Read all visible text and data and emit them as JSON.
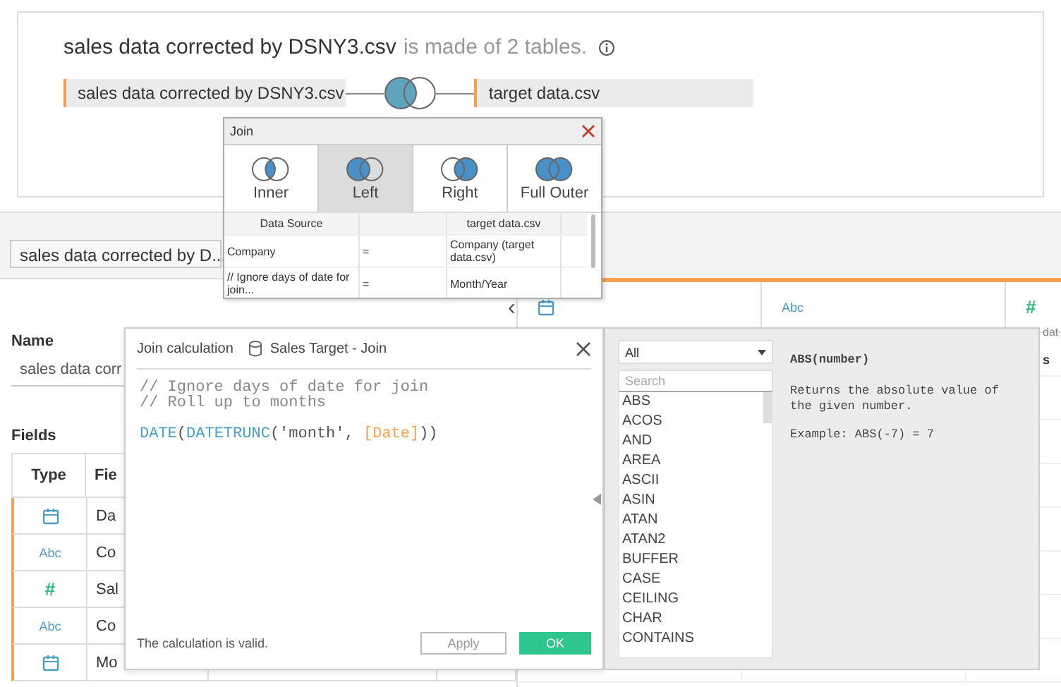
{
  "header": {
    "title": "sales data corrected by DSNY3.csv",
    "subtitle": "is made of 2 tables."
  },
  "join_diagram": {
    "left_table": "sales data corrected by DSNY3.csv",
    "right_table": "target data.csv",
    "left_shaded": true,
    "right_shaded": false
  },
  "source_selector": {
    "value": "sales data corrected by D..."
  },
  "details": {
    "name_label": "Name",
    "name_value": "sales data corr",
    "fields_label": "Fields",
    "collapse_glyph": "‹",
    "columns": [
      "Type",
      "Fie"
    ],
    "rows": [
      {
        "kind": "date",
        "field": "Da"
      },
      {
        "kind": "string",
        "glyph": "Abc",
        "field": "Co"
      },
      {
        "kind": "number",
        "glyph": "#",
        "field": "Sal"
      },
      {
        "kind": "string",
        "glyph": "Abc",
        "field": "Co"
      },
      {
        "kind": "date",
        "field": "Mo"
      }
    ]
  },
  "grid_header": {
    "columns": [
      {
        "kind": "date"
      },
      {
        "kind": "string",
        "glyph": "Abc"
      },
      {
        "kind": "number",
        "glyph": "#"
      }
    ],
    "fragments": [
      "dat",
      "s"
    ]
  },
  "join_popup": {
    "title": "Join",
    "join_types": [
      {
        "label": "Inner",
        "kind": "inner",
        "selected": false
      },
      {
        "label": "Left",
        "kind": "left",
        "selected": true
      },
      {
        "label": "Right",
        "kind": "right",
        "selected": false
      },
      {
        "label": "Full Outer",
        "kind": "full",
        "selected": false
      }
    ],
    "columns": [
      "Data Source",
      "target data.csv"
    ],
    "clauses": [
      {
        "left": "Company",
        "operator": "=",
        "right": "Company (target data.csv)"
      },
      {
        "left": "// Ignore days of date for join...",
        "operator": "=",
        "right": "Month/Year"
      }
    ]
  },
  "calc_dialog": {
    "title": "Join calculation",
    "source": "Sales Target - Join",
    "comments": [
      "// Ignore days of date for join",
      "// Roll up to months"
    ],
    "expression": [
      {
        "kind": "function",
        "text": "DATE"
      },
      {
        "kind": "punct",
        "text": "("
      },
      {
        "kind": "function",
        "text": "DATETRUNC"
      },
      {
        "kind": "punct",
        "text": "("
      },
      {
        "kind": "string",
        "text": "'month'"
      },
      {
        "kind": "punct",
        "text": ", "
      },
      {
        "kind": "field",
        "text": "[Date]"
      },
      {
        "kind": "punct",
        "text": "))"
      }
    ],
    "status": "The calculation is valid.",
    "buttons": [
      {
        "label": "Apply",
        "kind": "secondary"
      },
      {
        "label": "OK",
        "kind": "primary"
      }
    ]
  },
  "function_panel": {
    "category": "All",
    "search_placeholder": "Search",
    "functions": [
      "ABS",
      "ACOS",
      "AND",
      "AREA",
      "ASCII",
      "ASIN",
      "ATAN",
      "ATAN2",
      "BUFFER",
      "CASE",
      "CEILING",
      "CHAR",
      "CONTAINS"
    ],
    "signature": "ABS(number)",
    "description": "Returns the absolute value of the given number.",
    "example": "Example: ABS(-7) = 7"
  }
}
